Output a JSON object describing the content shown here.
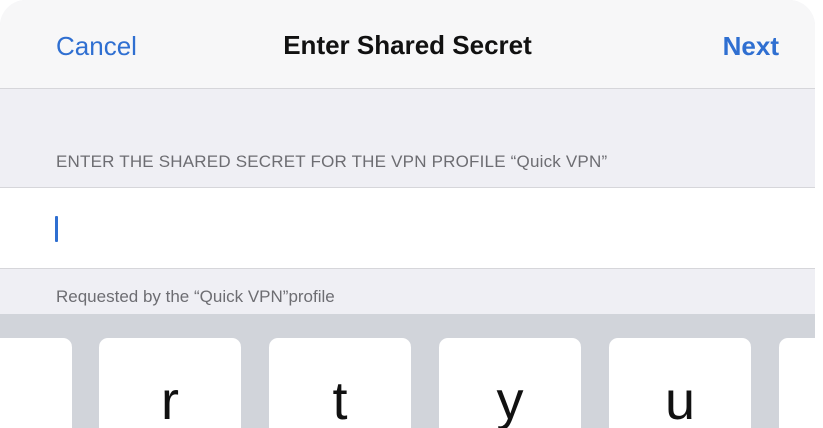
{
  "navbar": {
    "cancel_label": "Cancel",
    "title": "Enter Shared Secret",
    "next_label": "Next"
  },
  "form": {
    "section_header": "ENTER THE SHARED SECRET FOR THE VPN PROFILE “Quick VPN”",
    "secret_value": "",
    "footer": "Requested by the “Quick VPN”profile"
  },
  "keyboard": {
    "keys": [
      "r",
      "t",
      "y",
      "u"
    ]
  },
  "colors": {
    "accent": "#2f6fd1",
    "background": "#efeff4",
    "keyboard": "#d1d4da"
  }
}
